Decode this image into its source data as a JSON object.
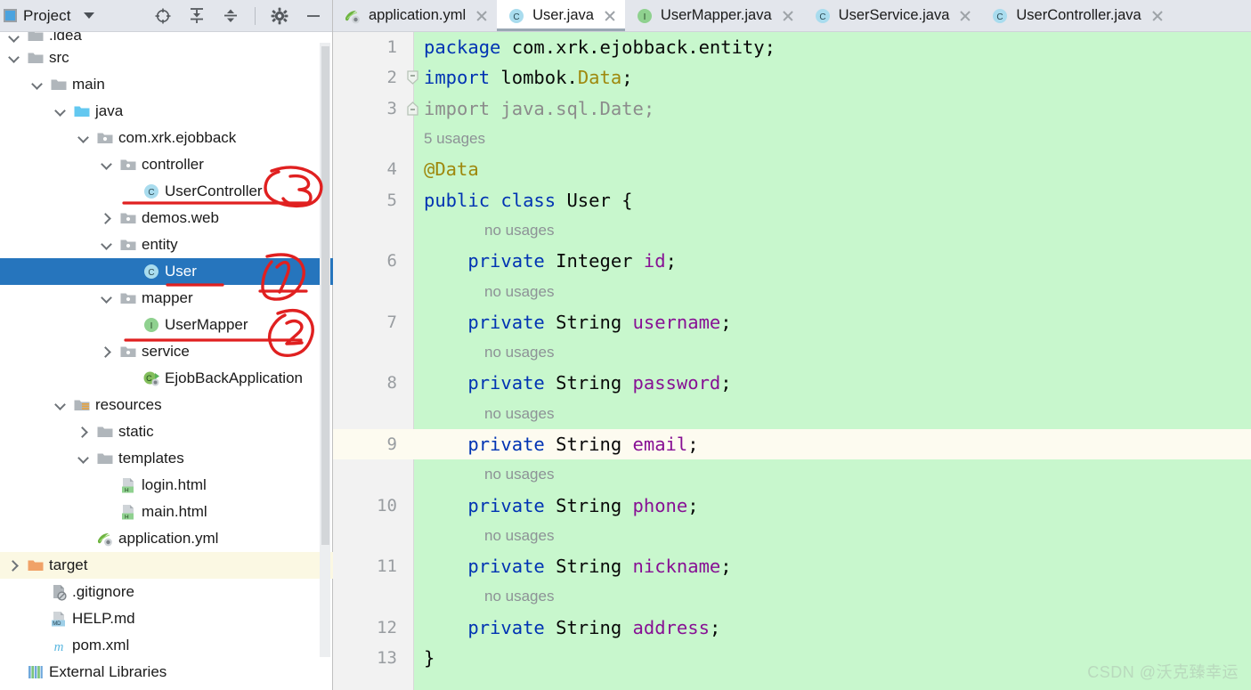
{
  "sidebar": {
    "title": "Project",
    "title_icon": "project-panel-icon",
    "dropdown_icon": "chevron-down-icon",
    "toolbar": [
      {
        "name": "locate-in-tree-icon",
        "label": "Select Opened File"
      },
      {
        "name": "expand-all-icon",
        "label": "Expand All"
      },
      {
        "name": "collapse-all-icon",
        "label": "Collapse All"
      },
      {
        "name": "settings-gear-icon",
        "label": "Options"
      },
      {
        "name": "minimize-icon",
        "label": "Hide"
      }
    ],
    "tree": [
      {
        "label": ".idea",
        "indent": 0,
        "arrow": "down",
        "icon": "folder-icon",
        "state": "clipped"
      },
      {
        "label": "src",
        "indent": 0,
        "arrow": "down",
        "icon": "folder-icon",
        "state": "normal"
      },
      {
        "label": "main",
        "indent": 1,
        "arrow": "down",
        "icon": "folder-icon",
        "state": "normal"
      },
      {
        "label": "java",
        "indent": 2,
        "arrow": "down",
        "icon": "folder-source-icon",
        "state": "normal"
      },
      {
        "label": "com.xrk.ejobback",
        "indent": 3,
        "arrow": "down",
        "icon": "package-icon",
        "state": "normal"
      },
      {
        "label": "controller",
        "indent": 4,
        "arrow": "down",
        "icon": "package-icon",
        "state": "normal"
      },
      {
        "label": "UserController",
        "indent": 5,
        "arrow": "none",
        "icon": "java-class-icon",
        "state": "normal"
      },
      {
        "label": "demos.web",
        "indent": 4,
        "arrow": "right",
        "icon": "package-icon",
        "state": "normal"
      },
      {
        "label": "entity",
        "indent": 4,
        "arrow": "down",
        "icon": "package-icon",
        "state": "normal"
      },
      {
        "label": "User",
        "indent": 5,
        "arrow": "none",
        "icon": "java-class-icon",
        "state": "selected"
      },
      {
        "label": "mapper",
        "indent": 4,
        "arrow": "down",
        "icon": "package-icon",
        "state": "normal"
      },
      {
        "label": "UserMapper",
        "indent": 5,
        "arrow": "none",
        "icon": "java-interface-icon",
        "state": "normal"
      },
      {
        "label": "service",
        "indent": 4,
        "arrow": "right",
        "icon": "package-icon",
        "state": "normal"
      },
      {
        "label": "EjobBackApplication",
        "indent": 5,
        "arrow": "none",
        "icon": "spring-boot-icon",
        "state": "normal"
      },
      {
        "label": "resources",
        "indent": 2,
        "arrow": "down",
        "icon": "folder-resource-icon",
        "state": "normal"
      },
      {
        "label": "static",
        "indent": 3,
        "arrow": "right",
        "icon": "folder-icon",
        "state": "normal"
      },
      {
        "label": "templates",
        "indent": 3,
        "arrow": "down",
        "icon": "folder-icon",
        "state": "normal"
      },
      {
        "label": "login.html",
        "indent": 4,
        "arrow": "none",
        "icon": "html-file-icon",
        "state": "normal"
      },
      {
        "label": "main.html",
        "indent": 4,
        "arrow": "none",
        "icon": "html-file-icon",
        "state": "normal"
      },
      {
        "label": "application.yml",
        "indent": 3,
        "arrow": "none",
        "icon": "spring-yaml-icon",
        "state": "normal"
      },
      {
        "label": "target",
        "indent": 0,
        "arrow": "right",
        "icon": "folder-excluded-icon",
        "state": "hovered"
      },
      {
        "label": ".gitignore",
        "indent": 1,
        "arrow": "none",
        "icon": "gitignore-icon",
        "state": "normal"
      },
      {
        "label": "HELP.md",
        "indent": 1,
        "arrow": "none",
        "icon": "markdown-file-icon",
        "state": "normal"
      },
      {
        "label": "pom.xml",
        "indent": 1,
        "arrow": "none",
        "icon": "maven-file-icon",
        "state": "normal"
      },
      {
        "label": "External Libraries",
        "indent": 0,
        "arrow": "none",
        "icon": "libraries-icon",
        "state": "normal"
      }
    ],
    "annotations": [
      {
        "name": "handwritten-mark-3",
        "text": "3",
        "target": "UserController"
      },
      {
        "name": "handwritten-mark-1",
        "text": "1",
        "target": "User"
      },
      {
        "name": "handwritten-mark-2",
        "text": "2",
        "target": "UserMapper"
      }
    ]
  },
  "editor": {
    "tabs": [
      {
        "label": "application.yml",
        "icon": "spring-yaml-icon",
        "active": false
      },
      {
        "label": "User.java",
        "icon": "java-class-icon",
        "active": true
      },
      {
        "label": "UserMapper.java",
        "icon": "java-interface-icon",
        "active": false
      },
      {
        "label": "UserService.java",
        "icon": "java-class-icon",
        "active": false
      },
      {
        "label": "UserController.java",
        "icon": "java-class-icon",
        "active": false
      }
    ],
    "lines": [
      {
        "num": "1",
        "hint": null,
        "caret": false,
        "fold": null,
        "tokens": [
          {
            "t": "package ",
            "c": "kw"
          },
          {
            "t": "com.xrk.ejobback.entity;",
            "c": "plain"
          }
        ]
      },
      {
        "num": "2",
        "hint": null,
        "caret": false,
        "fold": "start",
        "tokens": [
          {
            "t": "import ",
            "c": "kw"
          },
          {
            "t": "lombok.",
            "c": "plain"
          },
          {
            "t": "Data",
            "c": "ann"
          },
          {
            "t": ";",
            "c": "plain"
          }
        ]
      },
      {
        "num": "3",
        "hint": null,
        "caret": false,
        "fold": "end",
        "tokens": [
          {
            "t": "import java.sql.Date;",
            "c": "gray"
          }
        ]
      },
      {
        "num": "",
        "hint": "5 usages",
        "caret": false,
        "fold": null,
        "tokens": []
      },
      {
        "num": "4",
        "hint": null,
        "caret": false,
        "fold": null,
        "tokens": [
          {
            "t": "@Data",
            "c": "ann"
          }
        ]
      },
      {
        "num": "5",
        "hint": null,
        "caret": false,
        "fold": null,
        "tokens": [
          {
            "t": "public class ",
            "c": "kw"
          },
          {
            "t": "User {",
            "c": "plain"
          }
        ]
      },
      {
        "num": "",
        "hint": "no usages",
        "caret": false,
        "fold": null,
        "tokens": [],
        "indent": true
      },
      {
        "num": "6",
        "hint": null,
        "caret": false,
        "fold": null,
        "tokens": [
          {
            "t": "    ",
            "c": "plain"
          },
          {
            "t": "private ",
            "c": "kw"
          },
          {
            "t": "Integer ",
            "c": "plain"
          },
          {
            "t": "id",
            "c": "fld"
          },
          {
            "t": ";",
            "c": "plain"
          }
        ]
      },
      {
        "num": "",
        "hint": "no usages",
        "caret": false,
        "fold": null,
        "tokens": [],
        "indent": true
      },
      {
        "num": "7",
        "hint": null,
        "caret": false,
        "fold": null,
        "tokens": [
          {
            "t": "    ",
            "c": "plain"
          },
          {
            "t": "private ",
            "c": "kw"
          },
          {
            "t": "String ",
            "c": "plain"
          },
          {
            "t": "username",
            "c": "fld"
          },
          {
            "t": ";",
            "c": "plain"
          }
        ]
      },
      {
        "num": "",
        "hint": "no usages",
        "caret": false,
        "fold": null,
        "tokens": [],
        "indent": true
      },
      {
        "num": "8",
        "hint": null,
        "caret": false,
        "fold": null,
        "tokens": [
          {
            "t": "    ",
            "c": "plain"
          },
          {
            "t": "private ",
            "c": "kw"
          },
          {
            "t": "String ",
            "c": "plain"
          },
          {
            "t": "password",
            "c": "fld"
          },
          {
            "t": ";",
            "c": "plain"
          }
        ]
      },
      {
        "num": "",
        "hint": "no usages",
        "caret": false,
        "fold": null,
        "tokens": [],
        "indent": true
      },
      {
        "num": "9",
        "hint": null,
        "caret": true,
        "fold": null,
        "tokens": [
          {
            "t": "    ",
            "c": "plain"
          },
          {
            "t": "private ",
            "c": "kw"
          },
          {
            "t": "String ",
            "c": "plain"
          },
          {
            "t": "email",
            "c": "fld"
          },
          {
            "t": ";",
            "c": "plain"
          }
        ]
      },
      {
        "num": "",
        "hint": "no usages",
        "caret": false,
        "fold": null,
        "tokens": [],
        "indent": true
      },
      {
        "num": "10",
        "hint": null,
        "caret": false,
        "fold": null,
        "tokens": [
          {
            "t": "    ",
            "c": "plain"
          },
          {
            "t": "private ",
            "c": "kw"
          },
          {
            "t": "String ",
            "c": "plain"
          },
          {
            "t": "phone",
            "c": "fld"
          },
          {
            "t": ";",
            "c": "plain"
          }
        ]
      },
      {
        "num": "",
        "hint": "no usages",
        "caret": false,
        "fold": null,
        "tokens": [],
        "indent": true
      },
      {
        "num": "11",
        "hint": null,
        "caret": false,
        "fold": null,
        "tokens": [
          {
            "t": "    ",
            "c": "plain"
          },
          {
            "t": "private ",
            "c": "kw"
          },
          {
            "t": "String ",
            "c": "plain"
          },
          {
            "t": "nickname",
            "c": "fld"
          },
          {
            "t": ";",
            "c": "plain"
          }
        ]
      },
      {
        "num": "",
        "hint": "no usages",
        "caret": false,
        "fold": null,
        "tokens": [],
        "indent": true
      },
      {
        "num": "12",
        "hint": null,
        "caret": false,
        "fold": null,
        "tokens": [
          {
            "t": "    ",
            "c": "plain"
          },
          {
            "t": "private ",
            "c": "kw"
          },
          {
            "t": "String ",
            "c": "plain"
          },
          {
            "t": "address",
            "c": "fld"
          },
          {
            "t": ";",
            "c": "plain"
          }
        ]
      },
      {
        "num": "13",
        "hint": null,
        "caret": false,
        "fold": null,
        "tokens": [
          {
            "t": "}",
            "c": "plain"
          }
        ]
      }
    ],
    "watermark": "CSDN @沃克臻幸运"
  },
  "colors": {
    "selection_blue": "#2675BD",
    "code_added_green": "#C8F7CD",
    "caret_line": "#FDFBF0",
    "annotation_red": "#E02020",
    "keyword_blue": "#0033B3",
    "field_purple": "#871094",
    "annotation_gold": "#9E880D",
    "header_gray": "#E3E6EC"
  }
}
